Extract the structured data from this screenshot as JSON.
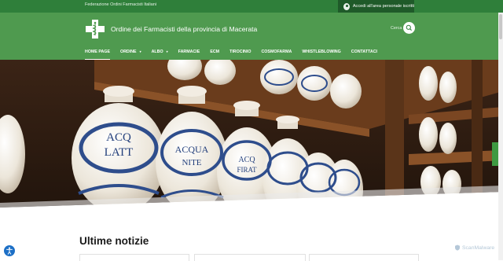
{
  "topbar": {
    "federation": "Federazione Ordini Farmacisti Italiani",
    "login_label": "Accedi all'area personale iscritti"
  },
  "header": {
    "site_title": "Ordine dei Farmacisti della provincia di Macerata",
    "search_label": "Cerca"
  },
  "nav": {
    "items": [
      {
        "label": "HOME PAGE",
        "active": true,
        "dropdown": false
      },
      {
        "label": "ORDINE",
        "active": false,
        "dropdown": true
      },
      {
        "label": "ALBO",
        "active": false,
        "dropdown": true
      },
      {
        "label": "FARMACIE",
        "active": false,
        "dropdown": false
      },
      {
        "label": "ECM",
        "active": false,
        "dropdown": false
      },
      {
        "label": "TIROCINIO",
        "active": false,
        "dropdown": false
      },
      {
        "label": "COSMOFARMA",
        "active": false,
        "dropdown": false
      },
      {
        "label": "WHISTLEBLOWING",
        "active": false,
        "dropdown": false
      },
      {
        "label": "CONTATTACI",
        "active": false,
        "dropdown": false
      }
    ]
  },
  "hero": {
    "jar_labels": [
      "ACQ",
      "LATT",
      "ACQUA",
      "NITE",
      "ACQ",
      "FIRAT"
    ]
  },
  "news": {
    "title": "Ultime notizie"
  },
  "watermark": "ScanMalware",
  "colors": {
    "topbar": "#2f7f3a",
    "header": "#4f9a4f",
    "login_button": "#1f5a29",
    "accessibility": "#1c6fc6"
  }
}
